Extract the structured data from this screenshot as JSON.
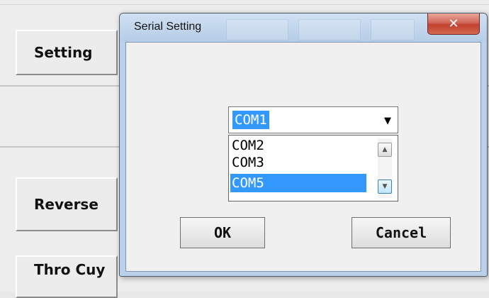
{
  "background": {
    "buttons": {
      "setting": "Setting",
      "reverse": "Reverse",
      "thro": "Thro Cuy"
    }
  },
  "dialog": {
    "title": "Serial Setting",
    "close_icon": "close-icon",
    "port_select": {
      "selected": "COM1",
      "options": [
        "COM2",
        "COM3",
        "COM5"
      ],
      "highlighted": "COM5"
    },
    "ok_label": "OK",
    "cancel_label": "Cancel"
  },
  "colors": {
    "selection": "#3399ff",
    "close": "#c3402f",
    "frame": "#b9d1ea"
  }
}
